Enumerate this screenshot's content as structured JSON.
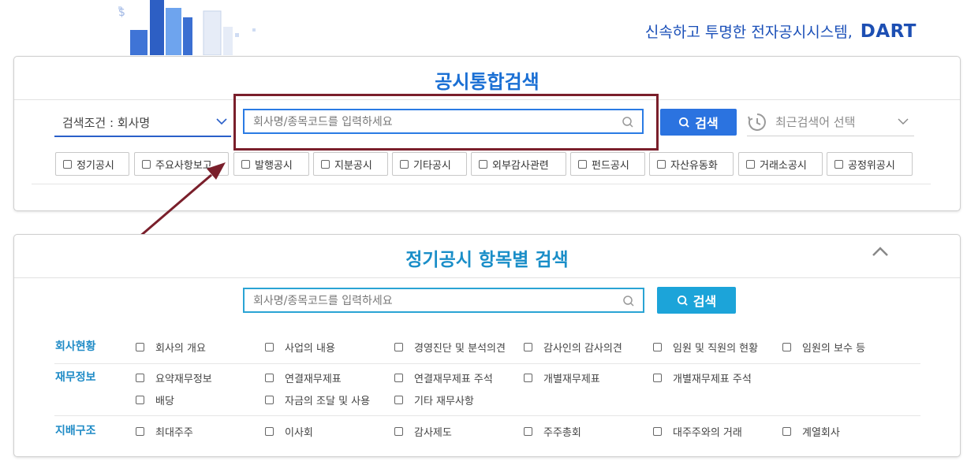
{
  "header": {
    "slogan": "신속하고 투명한 전자공시시스템,",
    "logo": "DART"
  },
  "integrated_search": {
    "title": "공시통합검색",
    "condition_label": "검색조건 : 회사명",
    "search_placeholder": "회사명/종목코드를 입력하세요",
    "search_button": "검색",
    "recent_label": "최근검색어 선택",
    "filters": [
      "정기공시",
      "주요사항보고",
      "발행공시",
      "지분공시",
      "기타공시",
      "외부감사관련",
      "펀드공시",
      "자산유동화",
      "거래소공시",
      "공정위공시"
    ]
  },
  "itemized_search": {
    "title": "정기공시 항목별 검색",
    "search_placeholder": "회사명/종목코드를 입력하세요",
    "search_button": "검색",
    "categories": [
      {
        "label": "회사현황",
        "items": [
          "회사의 개요",
          "사업의 내용",
          "경영진단 및 분석의견",
          "감사인의 감사의견",
          "임원 및 직원의 현황",
          "임원의 보수 등"
        ]
      },
      {
        "label": "재무정보",
        "items": [
          "요약재무정보",
          "연결재무제표",
          "연결재무제표 주석",
          "개별재무제표",
          "개별재무제표 주석",
          "배당",
          "자금의 조달 및 사용",
          "기타 재무사항"
        ]
      },
      {
        "label": "지배구조",
        "items": [
          "최대주주",
          "이사회",
          "감사제도",
          "주주총회",
          "대주주와의 거래",
          "계열회사"
        ]
      }
    ]
  },
  "colors": {
    "highlight_box": "#7a1f2b",
    "primary_blue": "#2b73e0",
    "teal_blue": "#1ca4d9"
  }
}
